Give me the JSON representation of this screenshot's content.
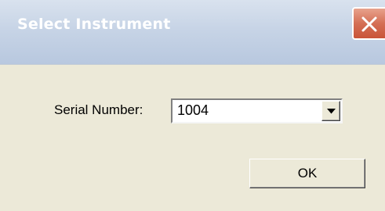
{
  "dialog": {
    "title": "Select Instrument",
    "close_icon": "close-icon",
    "serial_label": "Serial Number:",
    "serial_value": "1004",
    "dropdown_icon": "chevron-down-icon",
    "ok_label": "OK"
  },
  "colors": {
    "title_gradient_top": "#d9e2ee",
    "title_gradient_bottom": "#b8c8df",
    "close_button": "#d46f55",
    "dialog_background": "#ece9d8",
    "input_background": "#ffffff"
  }
}
